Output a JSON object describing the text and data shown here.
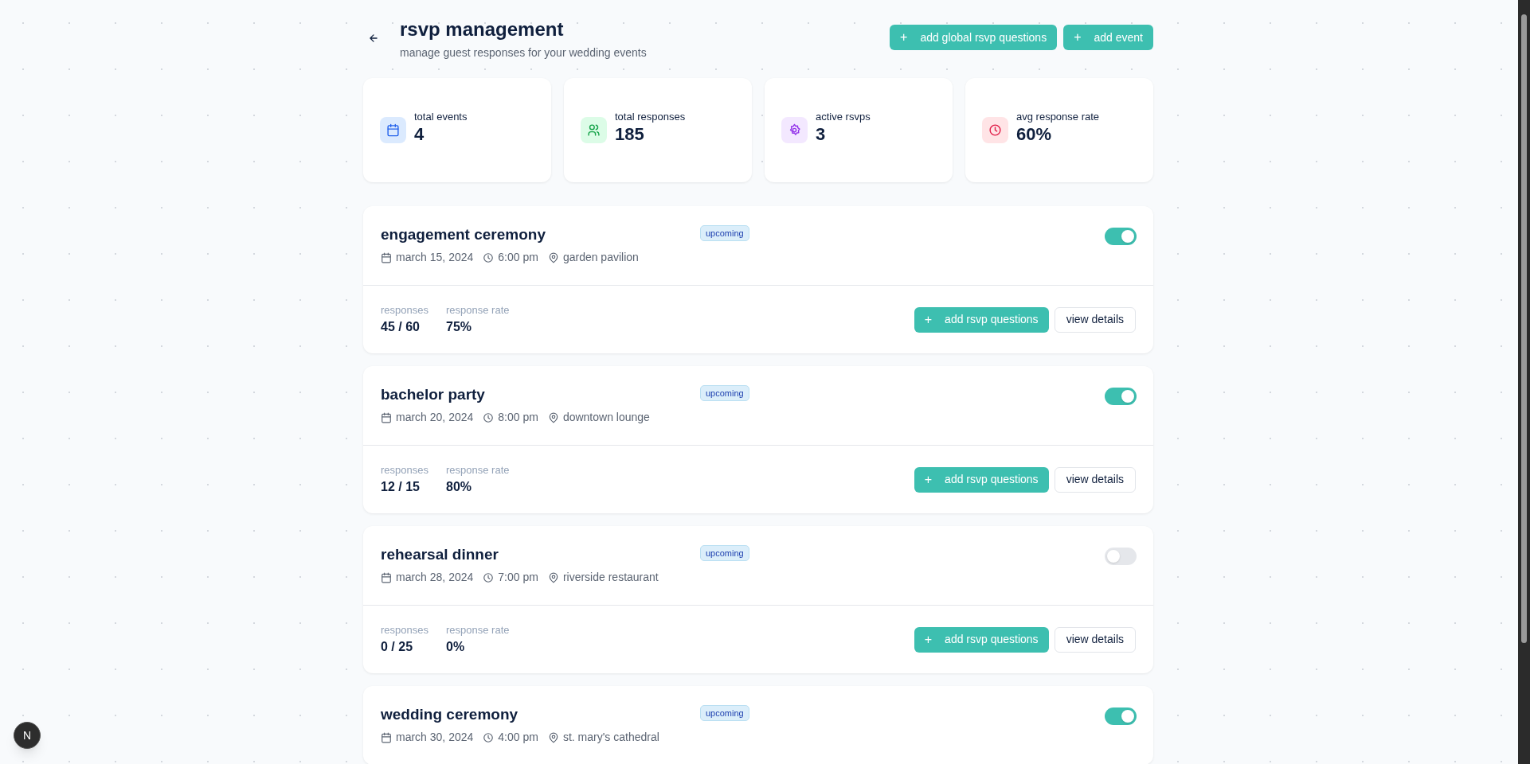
{
  "header": {
    "title": "rsvp management",
    "subtitle": "manage guest responses for your wedding events",
    "actions": [
      {
        "label": "add global rsvp questions",
        "icon": "+"
      },
      {
        "label": "add event",
        "icon": "+"
      }
    ]
  },
  "stats": [
    {
      "kind": "calendar",
      "label": "total events",
      "value": "4"
    },
    {
      "kind": "users",
      "label": "total responses",
      "value": "185"
    },
    {
      "kind": "gear",
      "label": "active rsvps",
      "value": "3"
    },
    {
      "kind": "clock",
      "label": "avg response rate",
      "value": "60%"
    }
  ],
  "events": [
    {
      "name": "engagement ceremony",
      "status": "upcoming",
      "enabled": true,
      "date": "march 15, 2024",
      "time": "6:00 pm",
      "location": "garden pavilion",
      "responses_label": "responses",
      "responses": "45 / 60",
      "rate_label": "response rate",
      "rate": "75%",
      "add_label": "add rsvp questions",
      "add_icon": "+",
      "details_label": "view details"
    },
    {
      "name": "bachelor party",
      "status": "upcoming",
      "enabled": true,
      "date": "march 20, 2024",
      "time": "8:00 pm",
      "location": "downtown lounge",
      "responses_label": "responses",
      "responses": "12 / 15",
      "rate_label": "response rate",
      "rate": "80%",
      "add_label": "add rsvp questions",
      "add_icon": "+",
      "details_label": "view details"
    },
    {
      "name": "rehearsal dinner",
      "status": "upcoming",
      "enabled": false,
      "date": "march 28, 2024",
      "time": "7:00 pm",
      "location": "riverside restaurant",
      "responses_label": "responses",
      "responses": "0 / 25",
      "rate_label": "response rate",
      "rate": "0%",
      "add_label": "add rsvp questions",
      "add_icon": "+",
      "details_label": "view details"
    },
    {
      "name": "wedding ceremony",
      "status": "upcoming",
      "enabled": true,
      "date": "march 30, 2024",
      "time": "4:00 pm",
      "location": "st. mary's cathedral"
    }
  ],
  "dev_badge": {
    "letter": "N"
  }
}
